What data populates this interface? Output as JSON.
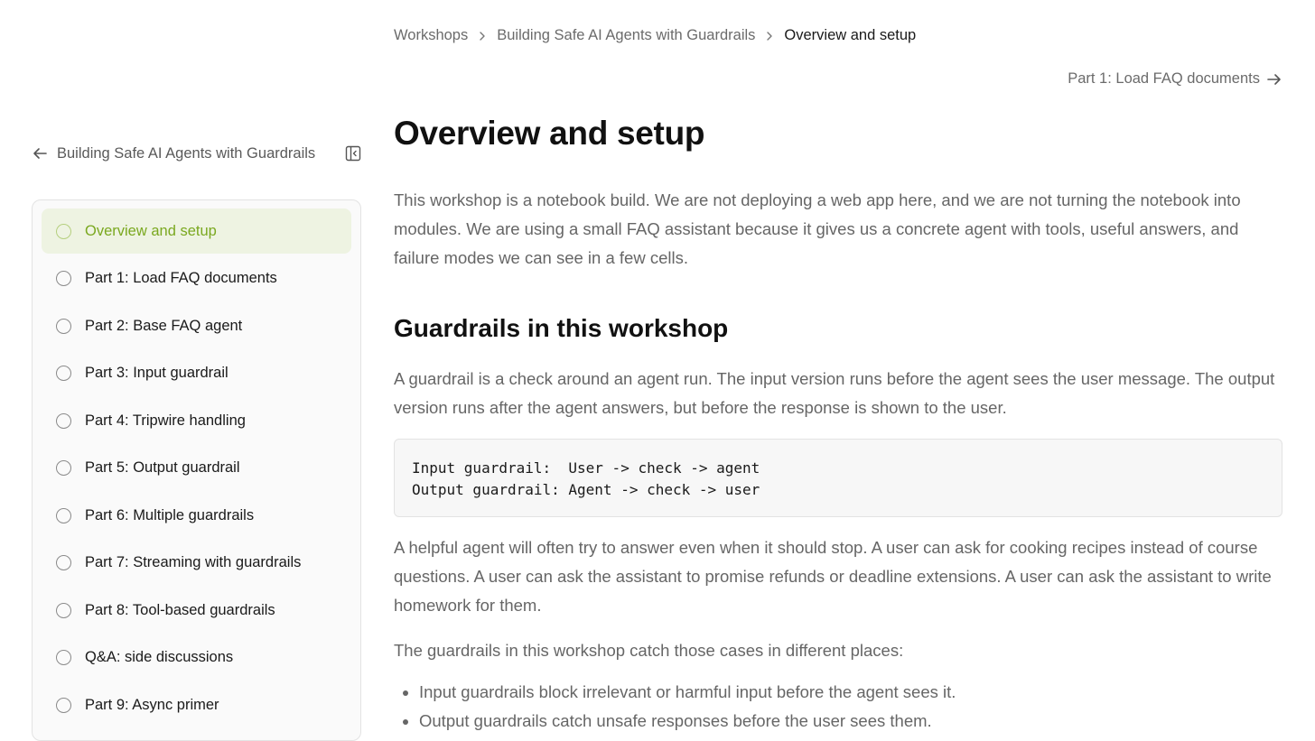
{
  "breadcrumb": {
    "items": [
      {
        "label": "Workshops"
      },
      {
        "label": "Building Safe AI Agents with Guardrails"
      },
      {
        "label": "Overview and setup"
      }
    ]
  },
  "next_link": {
    "label": "Part 1: Load FAQ documents",
    "icon": "arrow-right-icon"
  },
  "sidebar": {
    "title": "Building Safe AI Agents with Guardrails",
    "back_icon": "arrow-left-icon",
    "collapse_icon": "sidebar-collapse-icon",
    "items": [
      {
        "label": "Overview and setup",
        "active": true
      },
      {
        "label": "Part 1: Load FAQ documents"
      },
      {
        "label": "Part 2: Base FAQ agent"
      },
      {
        "label": "Part 3: Input guardrail"
      },
      {
        "label": "Part 4: Tripwire handling"
      },
      {
        "label": "Part 5: Output guardrail"
      },
      {
        "label": "Part 6: Multiple guardrails"
      },
      {
        "label": "Part 7: Streaming with guardrails"
      },
      {
        "label": "Part 8: Tool-based guardrails"
      },
      {
        "label": "Q&A: side discussions"
      },
      {
        "label": "Part 9: Async primer"
      }
    ]
  },
  "content": {
    "title": "Overview and setup",
    "intro": "This workshop is a notebook build. We are not deploying a web app here, and we are not turning the notebook into modules. We are using a small FAQ assistant because it gives us a concrete agent with tools, useful answers, and failure modes we can see in a few cells.",
    "section_title": "Guardrails in this workshop",
    "guardrail_text": "A guardrail is a check around an agent run. The input version runs before the agent sees the user message. The output version runs after the agent answers, but before the response is shown to the user.",
    "code": "Input guardrail:  User -> check -> agent\nOutput guardrail: Agent -> check -> user",
    "helpful_text": "A helpful agent will often try to answer even when it should stop. A user can ask for cooking recipes instead of course questions. A user can ask the assistant to promise refunds or deadline extensions. A user can ask the assistant to write homework for them.",
    "catch_text": "The guardrails in this workshop catch those cases in different places:",
    "bullets": [
      "Input guardrails block irrelevant or harmful input before the agent sees it.",
      "Output guardrails catch unsafe responses before the user sees them."
    ]
  },
  "colors": {
    "accent": "#7aa81f",
    "active_bg": "#eef3e2",
    "muted_text": "#666666"
  }
}
